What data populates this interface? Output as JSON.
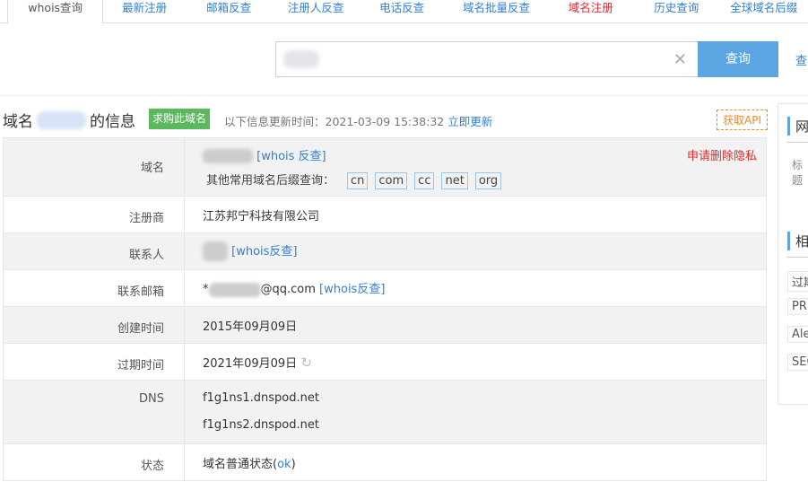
{
  "nav": {
    "tabs": [
      {
        "label": "whois查询",
        "active": true
      },
      {
        "label": "最新注册"
      },
      {
        "label": "邮箱反查"
      },
      {
        "label": "注册人反查"
      },
      {
        "label": "电话反查"
      },
      {
        "label": "域名批量反查"
      },
      {
        "label": "域名注册",
        "color": "#e8262c"
      },
      {
        "label": "历史查询"
      },
      {
        "label": "全球域名后缀"
      }
    ]
  },
  "search": {
    "button": "查询",
    "more": "查"
  },
  "header": {
    "prefix": "域名",
    "suffix": "的信息",
    "buy": "求购此域名",
    "update_text": "以下信息更新时间：2021-03-09 15:38:32",
    "update_link": "立即更新",
    "api": "获取API"
  },
  "rows": {
    "domain": {
      "label": "域名",
      "link": "[whois 反查]",
      "privacy": "申请删除隐私",
      "suffix_label": "其他常用域名后缀查询：",
      "suffixes": [
        "cn",
        "com",
        "cc",
        "net",
        "org"
      ]
    },
    "registrar": {
      "label": "注册商",
      "value": "江苏邦宁科技有限公司"
    },
    "contact": {
      "label": "联系人",
      "link": "[whois反查]"
    },
    "email": {
      "label": "联系邮箱",
      "prefix": "*",
      "suffix": "@qq.com",
      "link": "[whois反查]"
    },
    "created": {
      "label": "创建时间",
      "value": "2015年09月09日"
    },
    "expires": {
      "label": "过期时间",
      "value": "2021年09月09日"
    },
    "dns": {
      "label": "DNS",
      "values": [
        "f1g1ns1.dnspod.net",
        "f1g1ns2.dnspod.net"
      ]
    },
    "status": {
      "label": "状态",
      "value": "域名普通状态(",
      "code": "ok",
      "close": ")"
    }
  },
  "side": {
    "h1": "网",
    "sub": "标题",
    "h2": "相",
    "items": [
      "过期",
      "PR",
      "Alexa",
      "SEO"
    ]
  }
}
